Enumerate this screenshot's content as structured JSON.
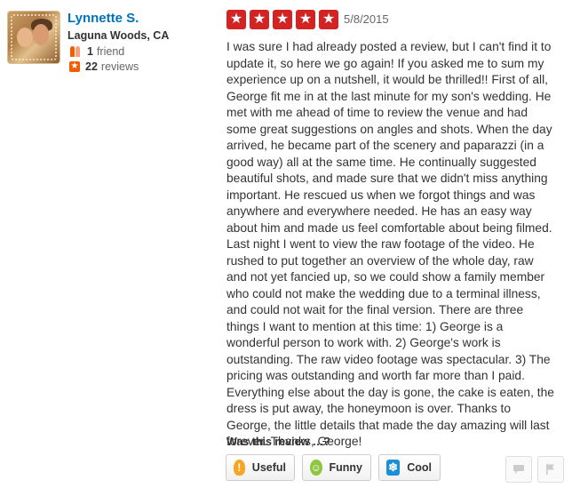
{
  "user": {
    "name": "Lynnette S.",
    "location": "Laguna Woods, CA",
    "friends_count": "1",
    "friends_label": "friend",
    "reviews_count": "22",
    "reviews_label": "reviews"
  },
  "review": {
    "rating": 5,
    "rating_max": 5,
    "date": "5/8/2015",
    "text": "I was sure I had already posted a review, but I can't find it to update it, so here we go again! If you asked me to sum my experience up on a nutshell, it would be thrilled!! First of all, George fit me in at the last minute for my son's wedding. He met with me ahead of time to review the venue and had some great suggestions on angles and shots. When the day arrived, he became part of the scenery and paparazzi (in a good way) all at the same time. He continually suggested beautiful shots, and made sure that we didn't miss anything important. He rescued us when we forgot things and was anywhere and everywhere needed. He has an easy way about him and made us feel comfortable about being filmed. Last night I went to view the raw footage of the video. He rushed to put together an overview of the whole day, raw and not yet fancied up, so we could show a family member who could not make the wedding due to a terminal illness, and could not wait for the final version. There are three things I want to mention at this time: 1) George is a wonderful person to work with. 2) George's work is outstanding. The raw video footage was spectacular. 3) The pricing was outstanding and worth far more than I paid. Everything else about the day is gone, the cake is eaten, the dress is put away, the honeymoon is over. Thanks to George, the little details that made the day amazing will last forever. Thanks, George!"
  },
  "feedback": {
    "prompt": "Was this review …?",
    "useful_label": "Useful",
    "funny_label": "Funny",
    "cool_label": "Cool"
  },
  "icons": {
    "star": "star-icon",
    "useful": "lightbulb-icon",
    "funny": "smiley-icon",
    "cool": "snowflake-icon",
    "message": "speech-bubble-icon",
    "flag": "flag-icon"
  },
  "colors": {
    "star_red": "#d32323",
    "link_blue": "#0073bb",
    "accent_orange": "#f15c00"
  }
}
